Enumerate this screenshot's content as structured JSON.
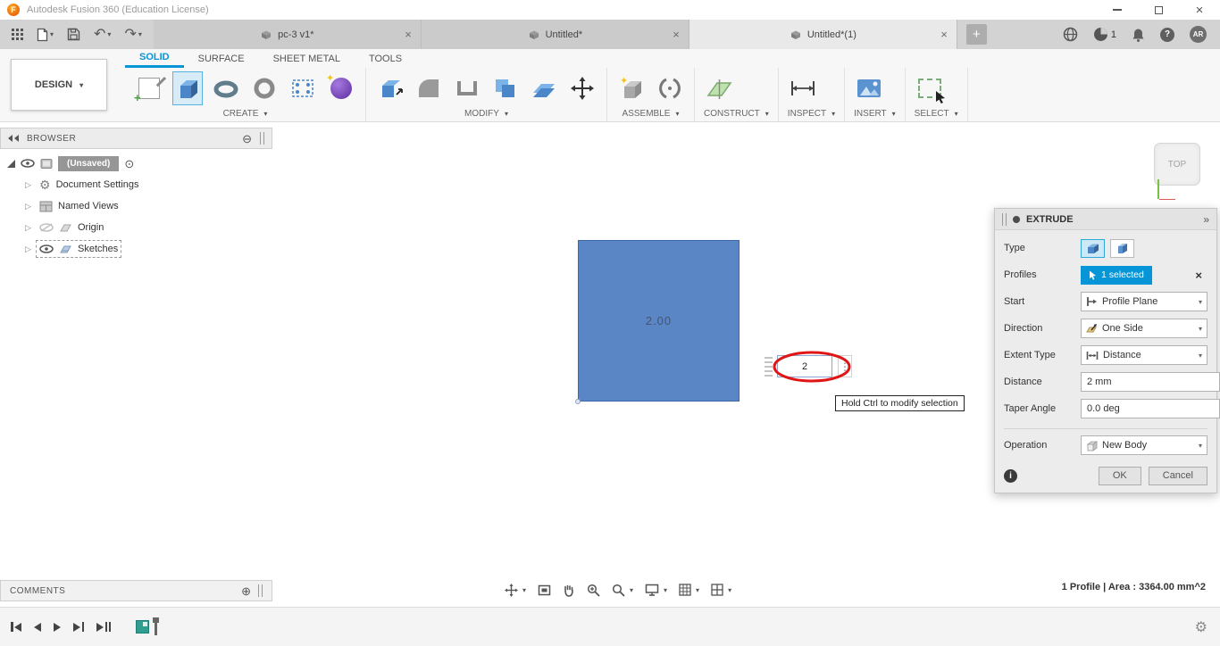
{
  "titlebar": {
    "title": "Autodesk Fusion 360 (Education License)",
    "logo": "F"
  },
  "tabstrip": {
    "tabs": [
      {
        "label": "pc-3 v1*"
      },
      {
        "label": "Untitled*"
      },
      {
        "label": "Untitled*(1)"
      }
    ],
    "add_label": "+",
    "job_badge": "1",
    "help": "?",
    "user_initials": "AR"
  },
  "ribbon": {
    "design_label": "DESIGN",
    "tabs": [
      {
        "label": "SOLID"
      },
      {
        "label": "SURFACE"
      },
      {
        "label": "SHEET METAL"
      },
      {
        "label": "TOOLS"
      }
    ],
    "groups": [
      {
        "label": "CREATE"
      },
      {
        "label": "MODIFY"
      },
      {
        "label": "ASSEMBLE"
      },
      {
        "label": "CONSTRUCT"
      },
      {
        "label": "INSPECT"
      },
      {
        "label": "INSERT"
      },
      {
        "label": "SELECT"
      }
    ]
  },
  "browser": {
    "title": "BROWSER",
    "root_label": "(Unsaved)",
    "items": [
      {
        "label": "Document Settings"
      },
      {
        "label": "Named Views"
      },
      {
        "label": "Origin"
      },
      {
        "label": "Sketches"
      }
    ]
  },
  "canvas": {
    "dimension_label": "2.00",
    "dimension_input": "2",
    "tooltip": "Hold Ctrl to modify selection",
    "viewcube_face": "TOP",
    "comments_label": "COMMENTS",
    "status": "1 Profile | Area : 3364.00 mm^2"
  },
  "extrude_dialog": {
    "title": "EXTRUDE",
    "rows": {
      "type": {
        "label": "Type"
      },
      "profiles": {
        "label": "Profiles",
        "chip": "1 selected"
      },
      "start": {
        "label": "Start",
        "value": "Profile Plane"
      },
      "direction": {
        "label": "Direction",
        "value": "One Side"
      },
      "extent_type": {
        "label": "Extent Type",
        "value": "Distance"
      },
      "distance": {
        "label": "Distance",
        "value": "2 mm"
      },
      "taper_angle": {
        "label": "Taper Angle",
        "value": "0.0 deg"
      },
      "operation": {
        "label": "Operation",
        "value": "New Body"
      }
    },
    "info": "i",
    "ok_label": "OK",
    "cancel_label": "Cancel"
  },
  "icons": {
    "caret": "▾",
    "close": "×",
    "undo": "↶",
    "redo": "↷",
    "circle_minus": "⊖",
    "circle_plus": "⊕",
    "circle_dot": "⊙",
    "dots_vertical": "⋮",
    "gear": "⚙",
    "chevrons_right": "»",
    "expander": "▷"
  },
  "colors": {
    "accent": "#0696d7",
    "body_blue": "#5b86c6",
    "annotation_red": "#e01616"
  }
}
